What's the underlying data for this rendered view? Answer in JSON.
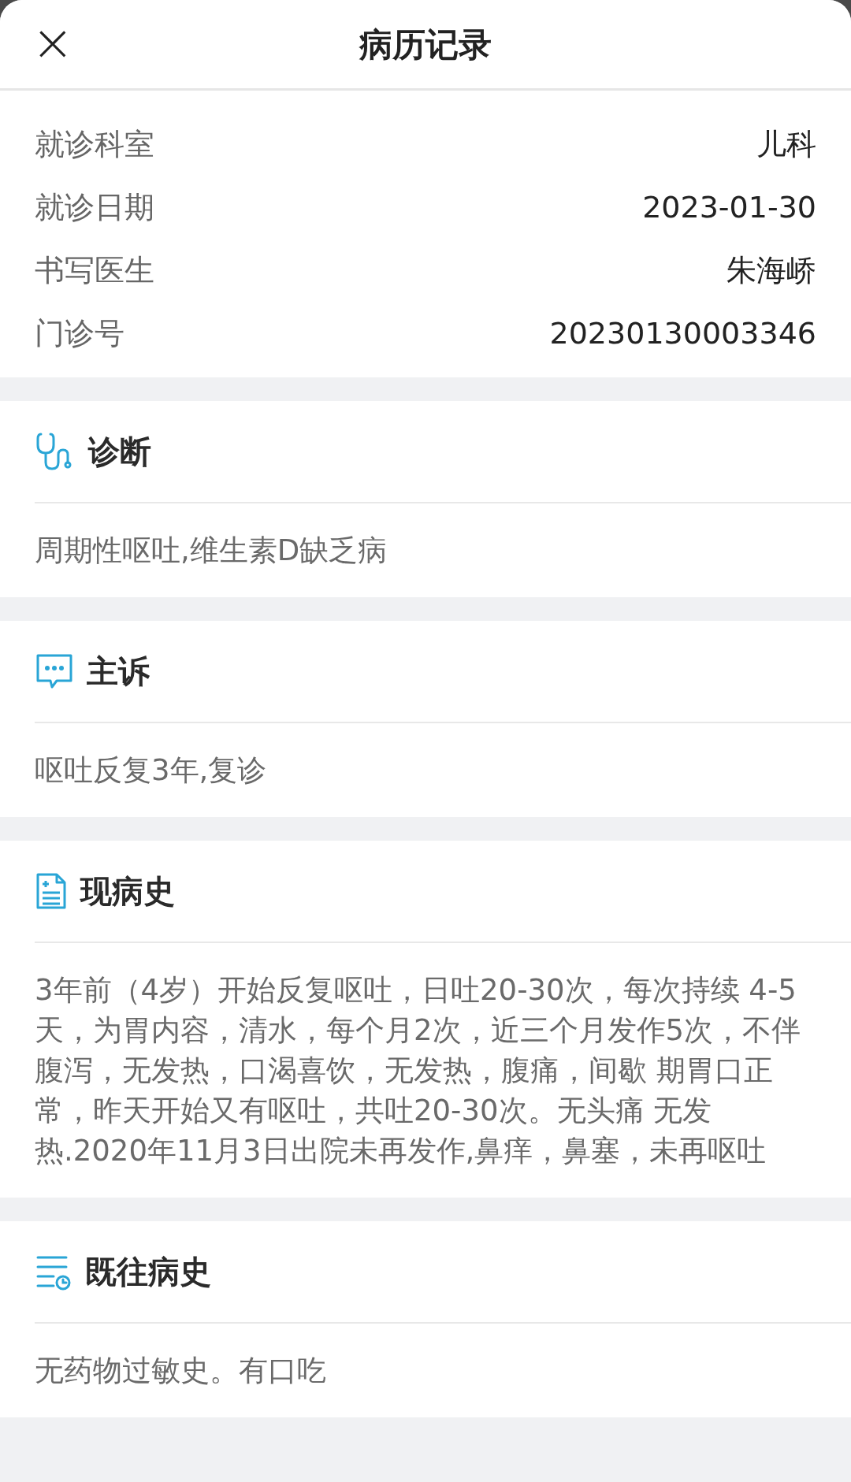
{
  "header": {
    "title": "病历记录",
    "close": "×"
  },
  "info": [
    {
      "label": "就诊科室",
      "value": "儿科"
    },
    {
      "label": "就诊日期",
      "value": "2023-01-30"
    },
    {
      "label": "书写医生",
      "value": "朱海峤"
    },
    {
      "label": "门诊号",
      "value": "20230130003346"
    }
  ],
  "sections": [
    {
      "kind": "diagnosis",
      "title": "诊断",
      "body": "周期性呕吐,维生素D缺乏病"
    },
    {
      "kind": "complaint",
      "title": "主诉",
      "body": "呕吐反复3年,复诊"
    },
    {
      "kind": "present",
      "title": "现病史",
      "body": "3年前（4岁）开始反复呕吐，日吐20-30次，每次持续 4-5天，为胃内容，清水，每个月2次，近三个月发作5次，不伴腹泻，无发热，口渴喜饮，无发热，腹痛，间歇 期胃口正常，昨天开始又有呕吐，共吐20-30次。无头痛 无发热.2020年11月3日出院未再发作,鼻痒，鼻塞，未再呕吐"
    },
    {
      "kind": "past",
      "title": "既往病史",
      "body": "无药物过敏史。有口吃"
    }
  ]
}
